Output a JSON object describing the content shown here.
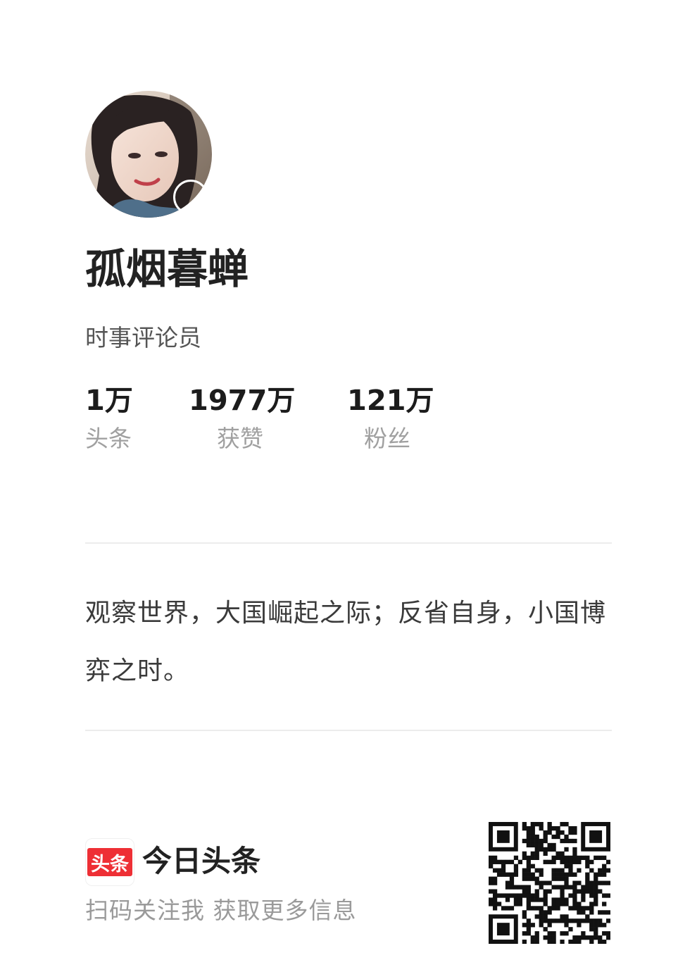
{
  "profile": {
    "avatar": "profile-photo",
    "name": "孤烟暮蝉",
    "title": "时事评论员"
  },
  "stats": [
    {
      "value": "1万",
      "label": "头条"
    },
    {
      "value": "1977万",
      "label": "获赞"
    },
    {
      "value": "121万",
      "label": "粉丝"
    }
  ],
  "bio": "观察世界，大国崛起之际；反省自身，小国博弈之时。",
  "footer": {
    "logo_text": "头条",
    "app_name": "今日头条",
    "scan_text": "扫码关注我 获取更多信息",
    "qr_icon": "qr-code"
  },
  "colors": {
    "brand_red": "#ee2f35",
    "label_gray": "#a0a0a0",
    "divider": "#ececec"
  }
}
